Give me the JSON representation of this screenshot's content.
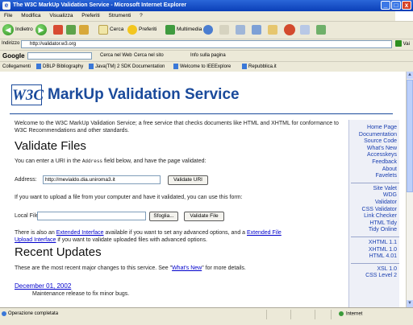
{
  "window": {
    "title": "The W3C MarkUp Validation Service - Microsoft Internet Explorer",
    "btn_min": "_",
    "btn_max": "□",
    "btn_close": "x"
  },
  "menu": [
    "File",
    "Modifica",
    "Visualizza",
    "Preferiti",
    "Strumenti",
    "?"
  ],
  "toolbar": {
    "back": "Indietro",
    "search": "Cerca",
    "favorites": "Preferiti",
    "multimedia": "Multimedia"
  },
  "address": {
    "label": "Indirizzo",
    "url": "http://validator.w3.org",
    "go": "Vai"
  },
  "google": {
    "logo": "Google",
    "search_web": "Cerca nel Web",
    "search_site": "Cerca nel sito",
    "page_info": "Info sulla pagina"
  },
  "links": {
    "label": "Collegamenti",
    "items": [
      "DBLP Bibliography",
      "Java(TM) 2 SDK Documentation",
      "Welcome to IEEExplore",
      "Repubblica.it"
    ]
  },
  "page": {
    "logo_text": "W3C",
    "title": "MarkUp Validation Service",
    "intro": "Welcome to the W3C MarkUp Validation Service; a free service that checks documents like HTML and XHTML for conformance to W3C Recommendations and other standards.",
    "validate_heading": "Validate Files",
    "uri_text_pre": "You can enter a URI in the",
    "uri_text_tt": "Address",
    "uri_text_post": "field below, and have the page validated:",
    "address_label": "Address:",
    "address_value": "http://mevialdo.dia.uniroma3.it",
    "validate_uri_button": "Validate URI",
    "upload_text": "If you want to upload a file from your computer and have it validated, you can use this form:",
    "localfile_label": "Local File:",
    "browse_button": "Sfoglia...",
    "validate_file_button": "Validate File",
    "extended_pre": "There is also an",
    "extended_link": "Extended Interface",
    "extended_mid": "available if you want to set any advanced options, and a",
    "extended_file_link_1": "Extended File",
    "extended_file_link_2": "Upload Interface",
    "extended_post": "if you want to validate uploaded files with advanced options.",
    "updates_heading": "Recent Updates",
    "updates_pre": "These are the most recent major changes to this service. See \"",
    "updates_link": "What's New",
    "updates_post": "\" for more details.",
    "update_date": "December 01, 2002",
    "update_text": "Maintenance release to fix minor bugs."
  },
  "nav": {
    "group1": [
      "Home Page",
      "Documentation",
      "Source Code",
      "What's New",
      "Accesskeys",
      "Feedback",
      "About",
      "Favelets"
    ],
    "group2": [
      "Site Valet",
      "WDG",
      "Validator",
      "CSS Validator",
      "Link Checker",
      "HTML Tidy",
      "Tidy Online"
    ],
    "group3": [
      "XHTML 1.1",
      "XHTML 1.0",
      "HTML 4.01"
    ],
    "group4": [
      "XSL 1.0",
      "CSS Level 2"
    ]
  },
  "status": {
    "text": "Operazione completata",
    "zone": "Internet"
  }
}
